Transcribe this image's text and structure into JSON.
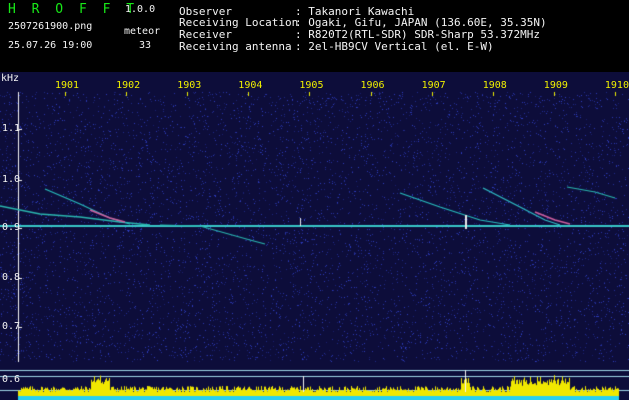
{
  "header": {
    "app_name": "H R O F F T",
    "version": "1.0.0",
    "filename": "2507261900.png",
    "datetime": "25.07.26 19:00",
    "meteor_label": "meteor",
    "meteor_count": "33",
    "info": [
      {
        "label": "Observer",
        "value": ": Takanori Kawachi"
      },
      {
        "label": "Receiving Location",
        "value": ": Ogaki, Gifu, JAPAN (136.60E, 35.35N)"
      },
      {
        "label": "Receiver",
        "value": ": R820T2(RTL-SDR) SDR-Sharp 53.372MHz"
      },
      {
        "label": "Receiving antenna",
        "value": ": 2el-HB9CV Vertical (el. E-W)"
      }
    ]
  },
  "spectrogram": {
    "unit_label": "kHz",
    "time_ticks": [
      "1901",
      "1902",
      "1903",
      "1904",
      "1905",
      "1906",
      "1907",
      "1908",
      "1909",
      "1910"
    ],
    "freq_ticks": [
      "1.1",
      "1.0",
      "0.9",
      "0.8",
      "0.7",
      "0.6"
    ],
    "lower_tick": "0.6",
    "colors": {
      "background": "#0d0d3a",
      "noise": "#3040c8",
      "carrier": "#38c8c8",
      "header_green": "#18e818",
      "tick_yellow": "#f0f000",
      "activity_yellow": "#f0e800",
      "activity_cyan": "#28d0f0"
    }
  }
}
